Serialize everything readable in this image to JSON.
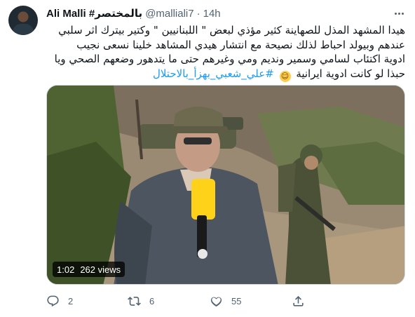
{
  "tweet": {
    "author_name": "Ali Malli #بالمختصر",
    "handle": "@malliali7",
    "separator": "·",
    "time": "14h",
    "text_lines": [
      "هيدا المشهد المذل للصهاينة كثير مؤذي لبعض \" اللبنانيين \" وكتير بيترك اثر سلبي",
      "عندهم وبيولد احباط لذلك نصيحة مع انتشار هيدي المشاهد خلينا نسعى نجيب",
      "ادوية اكتئاب لسامي وسمير ونديم ومي وغيرهم حتى ما يتدهور وضعهم الصحي ويا",
      "حبذا لو كانت ادوية ايرانية"
    ],
    "emoji": "smiling-face",
    "hashtag": "#علي_شعبي_بهزأ_بالاحتلال"
  },
  "video": {
    "duration": "1:02",
    "views": "262 views"
  },
  "actions": {
    "replies": "2",
    "retweets": "6",
    "likes": "55"
  },
  "colors": {
    "accent": "#1d9bf0",
    "secondary_text": "#536471",
    "primary_text": "#0f1419",
    "border": "#cfd9de"
  }
}
